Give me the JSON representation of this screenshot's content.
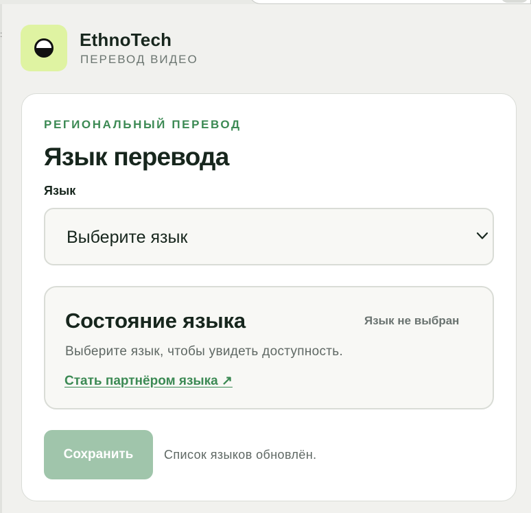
{
  "header": {
    "logo_icon": "half-moon-icon",
    "brand_name": "EthnoTech",
    "brand_subtitle": "ПЕРЕВОД ВИДЕО",
    "logo_bg_color": "#dff3a2"
  },
  "card": {
    "eyebrow": "РЕГИОНАЛЬНЫЙ ПЕРЕВОД",
    "title": "Язык перевода",
    "language_field": {
      "label": "Язык",
      "selected_value": "Выберите язык",
      "icon": "chevron-down-icon"
    },
    "status": {
      "title": "Состояние языка",
      "badge": "Язык не выбран",
      "description": "Выберите язык, чтобы увидеть доступность.",
      "link_label": "Стать партнёром языка ↗"
    },
    "footer": {
      "save_label": "Сохранить",
      "status_text": "Список языков обновлён."
    }
  },
  "colors": {
    "accent": "#3c8a54",
    "save_button_disabled": "#a0c5ab",
    "text_primary": "#17261d",
    "text_muted": "#5f6864"
  }
}
